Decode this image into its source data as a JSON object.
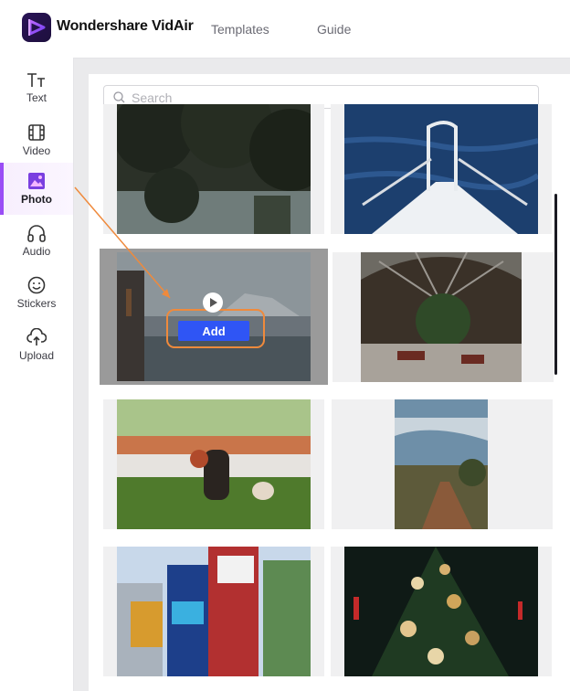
{
  "header": {
    "brand": "Wondershare VidAir",
    "nav": {
      "templates": "Templates",
      "guide": "Guide"
    }
  },
  "sidebar": {
    "items": [
      {
        "label": "Text",
        "icon": "text-icon"
      },
      {
        "label": "Video",
        "icon": "film-icon"
      },
      {
        "label": "Photo",
        "icon": "image-icon",
        "active": true
      },
      {
        "label": "Audio",
        "icon": "headphones-icon"
      },
      {
        "label": "Stickers",
        "icon": "smiley-icon"
      },
      {
        "label": "Upload",
        "icon": "cloud-upload-icon"
      }
    ]
  },
  "search": {
    "placeholder": "Search",
    "value": ""
  },
  "photos": [
    {
      "subject": "forest-lake"
    },
    {
      "subject": "boat-bow-ocean"
    },
    {
      "subject": "harbor-mountain",
      "hovered": true
    },
    {
      "subject": "train-station-interior"
    },
    {
      "subject": "child-with-dog"
    },
    {
      "subject": "dirt-road-sky"
    },
    {
      "subject": "city-billboards"
    },
    {
      "subject": "christmas-tree"
    }
  ],
  "hover_actions": {
    "add_label": "Add"
  },
  "colors": {
    "accent": "#9a4df5",
    "button": "#2f55f5",
    "annotation": "#ef8a3c"
  }
}
